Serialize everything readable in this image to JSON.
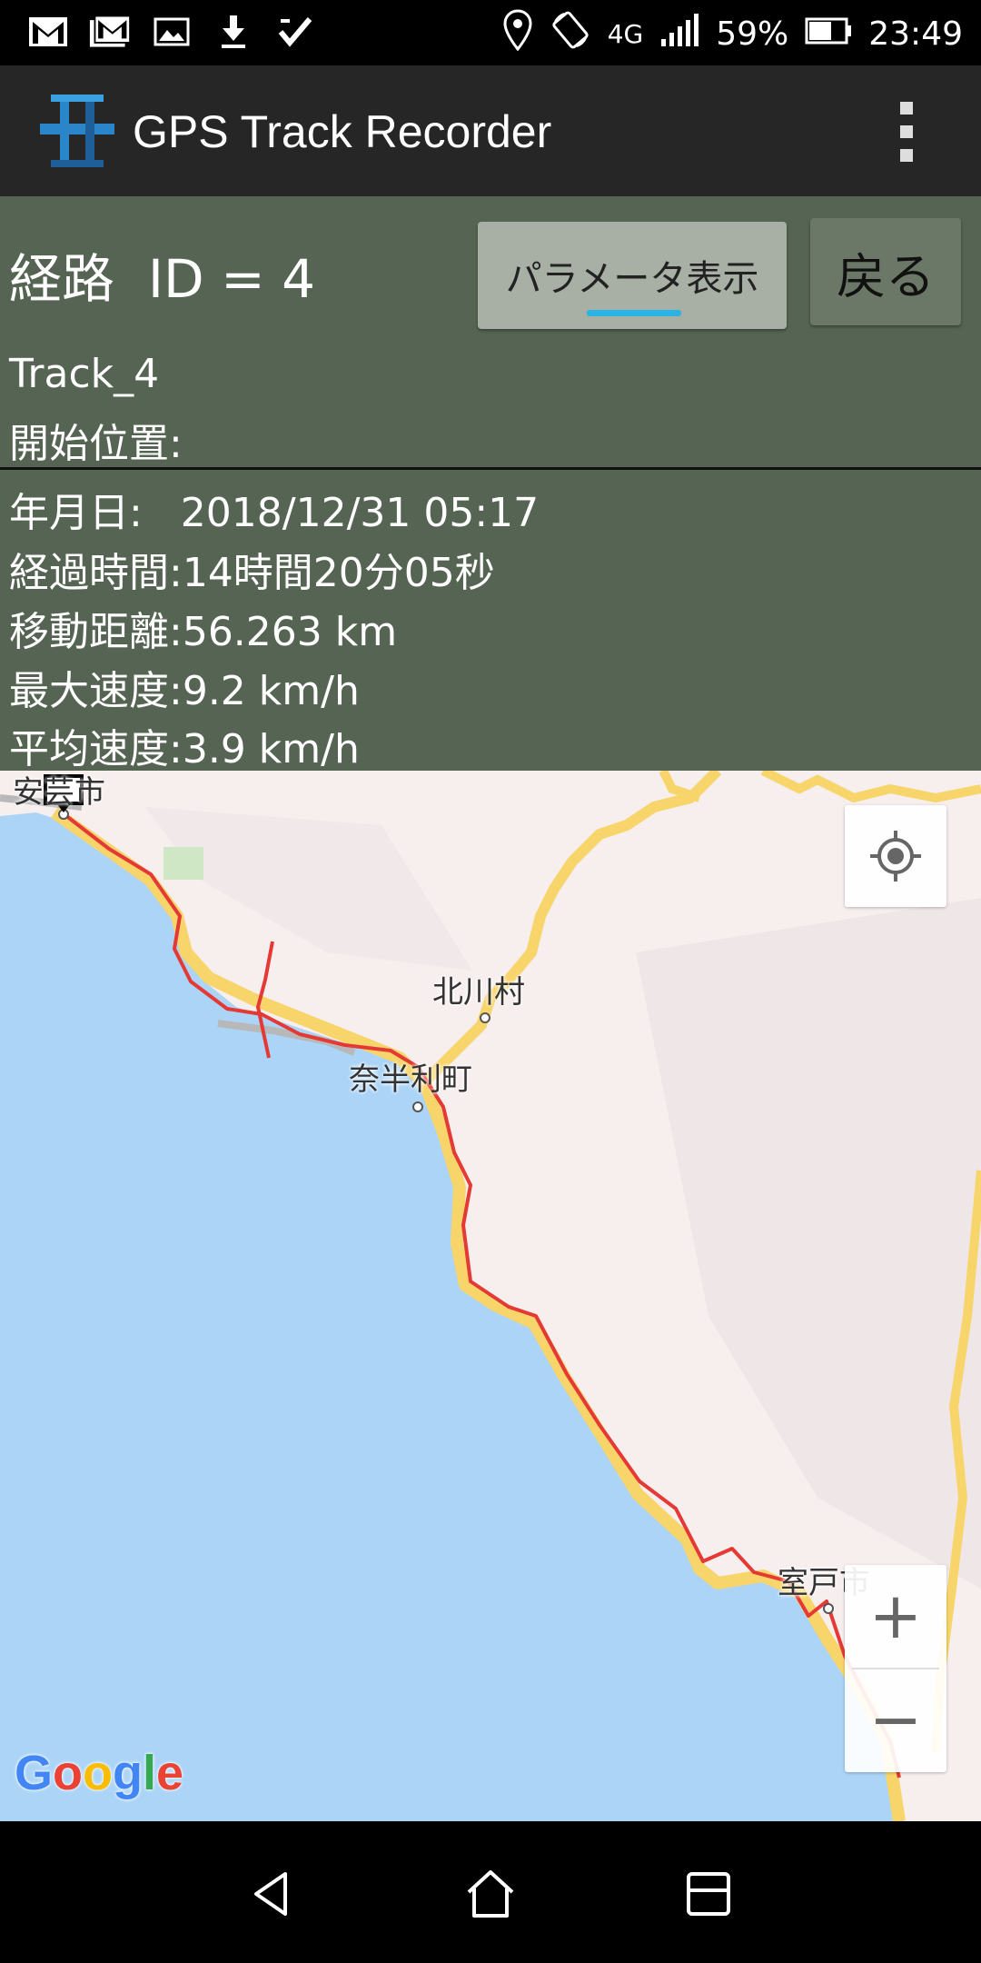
{
  "status_bar": {
    "network": "4G",
    "battery": "59%",
    "time": "23:49"
  },
  "app": {
    "title": "GPS Track Recorder"
  },
  "route": {
    "title": "経路  ID = 4",
    "param_button": "パラメータ表示",
    "back_button": "戻る",
    "track_name": "Track_4",
    "start_position": "開始位置:",
    "date": "年月日:   2018/12/31 05:17",
    "elapsed": "経過時間:14時間20分05秒",
    "distance": "移動距離:56.263 km",
    "max_speed": "最大速度:9.2 km/h",
    "avg_speed": "平均速度:3.9 km/h"
  },
  "map": {
    "labels": {
      "aki": "安芸市",
      "kitagawa": "北川村",
      "nahari": "奈半利町",
      "muroto": "室戸市"
    },
    "zoom_in": "+",
    "zoom_out": "−",
    "attribution": "Google",
    "colors": {
      "sea": "#abd4f7",
      "land": "#f7eeee",
      "road": "#f7d56b",
      "track": "#e53935"
    }
  }
}
